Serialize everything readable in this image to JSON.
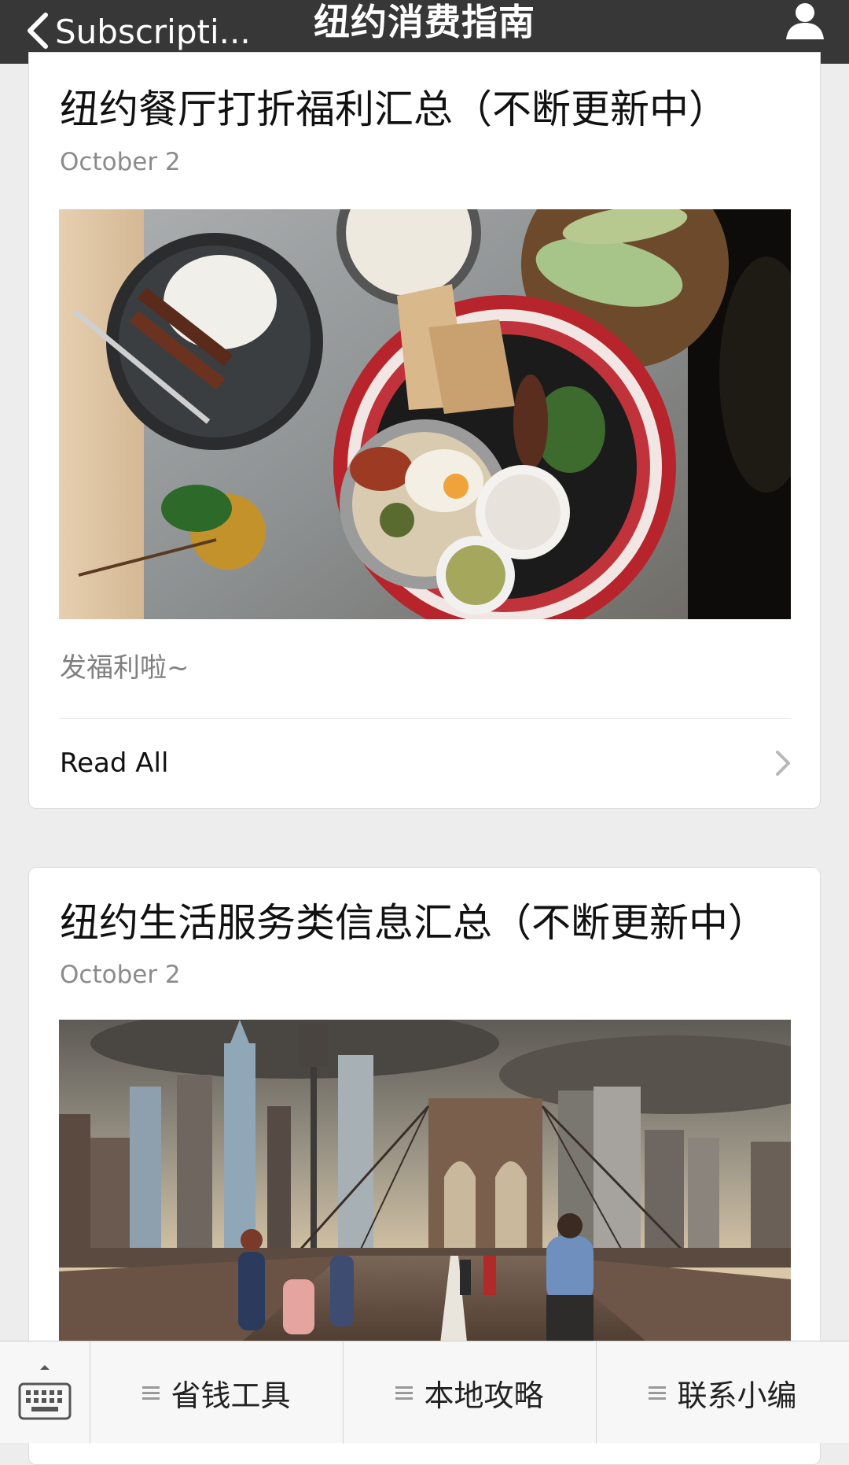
{
  "nav": {
    "back_label": "Subscripti...",
    "title": "纽约消费指南"
  },
  "articles": [
    {
      "title": "纽约餐厅打折福利汇总（不断更新中）",
      "date": "October 2",
      "summary": "发福利啦~",
      "read_all": "Read All",
      "image_icon": "food-photo"
    },
    {
      "title": "纽约生活服务类信息汇总（不断更新中）",
      "date": "October 2",
      "image_icon": "brooklyn-bridge-photo"
    }
  ],
  "menu": {
    "items": [
      {
        "label": "省钱工具"
      },
      {
        "label": "本地攻略"
      },
      {
        "label": "联系小编"
      }
    ]
  },
  "colors": {
    "navbar_bg": "#373737",
    "page_bg": "#ededed",
    "card_bg": "#ffffff",
    "date_gray": "#8b8b8b"
  }
}
